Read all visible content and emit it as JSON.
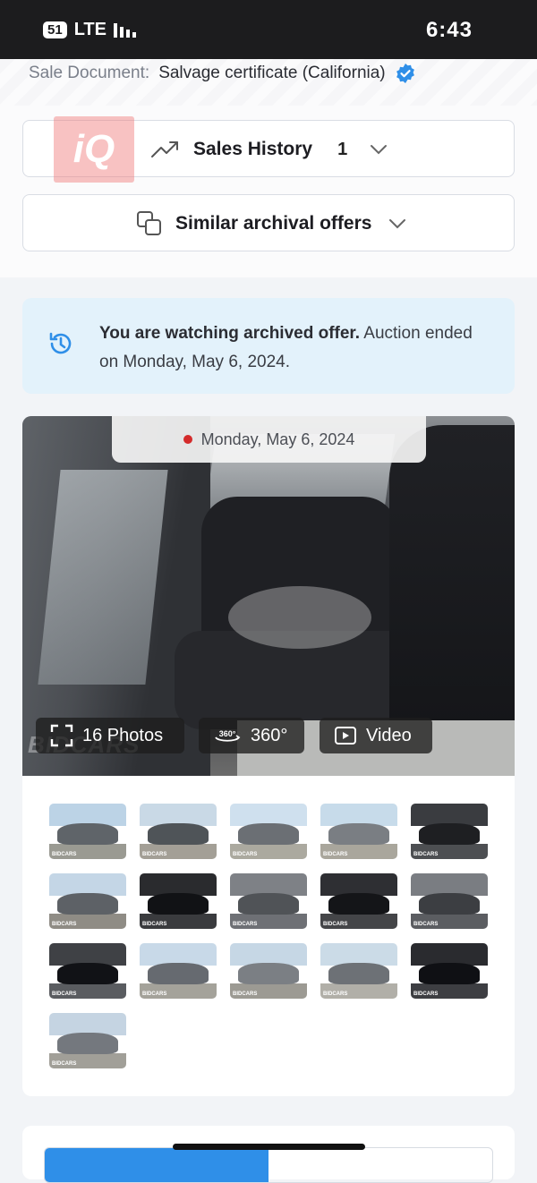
{
  "status_bar": {
    "badge": "51",
    "network": "LTE",
    "time": "6:43"
  },
  "sale_document": {
    "label": "Sale Document:",
    "value": "Salvage certificate (California)"
  },
  "watermark_logo": "iQ",
  "sales_history": {
    "label": "Sales History",
    "count": "1"
  },
  "similar_offers": {
    "label": "Similar archival offers"
  },
  "archived_notice": {
    "bold": "You are watching archived offer.",
    "rest": " Auction ended on Monday, May 6, 2024."
  },
  "gallery": {
    "date": "Monday, May 6, 2024",
    "watermark": "BIDCARS",
    "photos_label": "16 Photos",
    "view360_label": "360°",
    "video_label": "Video",
    "thumbnails": [
      {
        "tag": "BIDCARS"
      },
      {
        "tag": "BIDCARS"
      },
      {
        "tag": "BIDCARS"
      },
      {
        "tag": "BIDCARS"
      },
      {
        "tag": "BIDCARS"
      },
      {
        "tag": "BIDCARS"
      },
      {
        "tag": "BIDCARS"
      },
      {
        "tag": "BIDCARS"
      },
      {
        "tag": "BIDCARS"
      },
      {
        "tag": "BIDCARS"
      },
      {
        "tag": "BIDCARS"
      },
      {
        "tag": "BIDCARS"
      },
      {
        "tag": "BIDCARS"
      },
      {
        "tag": "BIDCARS"
      },
      {
        "tag": "BIDCARS"
      },
      {
        "tag": "BIDCARS"
      }
    ]
  },
  "bottom": {
    "progress": 0.5
  },
  "colors": {
    "accent": "#2f8fe8",
    "info_bg": "#e3f2fb",
    "red_dot": "#d42b2b",
    "verified": "#2f8fe8"
  }
}
